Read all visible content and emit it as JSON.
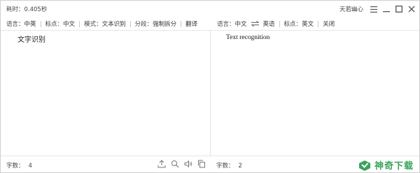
{
  "titlebar": {
    "elapsed": "耗时：0.405秒",
    "brand": "天若幽心",
    "icons": [
      "menu-icon",
      "minimize-icon",
      "maximize-icon",
      "close-icon"
    ]
  },
  "left_options": {
    "language_label": "语言：",
    "language_value": "中英",
    "punct_label": "标点：",
    "punct_value": "中文",
    "mode_label": "模式：",
    "mode_value": "文本识别",
    "segment_label": "分段：",
    "segment_value": "强制拆分",
    "translate": "翻译"
  },
  "right_options": {
    "language_label": "语言：",
    "source_lang": "中文",
    "swap_icon": "swap-arrows-icon",
    "target_lang": "英语",
    "punct_label": "标点：",
    "punct_value": "英文",
    "close": "关闭"
  },
  "source": {
    "text": "文字识别"
  },
  "translation": {
    "text": "Text recognition"
  },
  "left_footer": {
    "count_label": "字数：",
    "count_value": "4",
    "tools": [
      "upload-icon",
      "search-icon",
      "speaker-icon",
      "copy-icon"
    ]
  },
  "right_footer": {
    "count_label": "字数：",
    "count_value": "2"
  },
  "watermark": {
    "text": "神奇下载"
  }
}
